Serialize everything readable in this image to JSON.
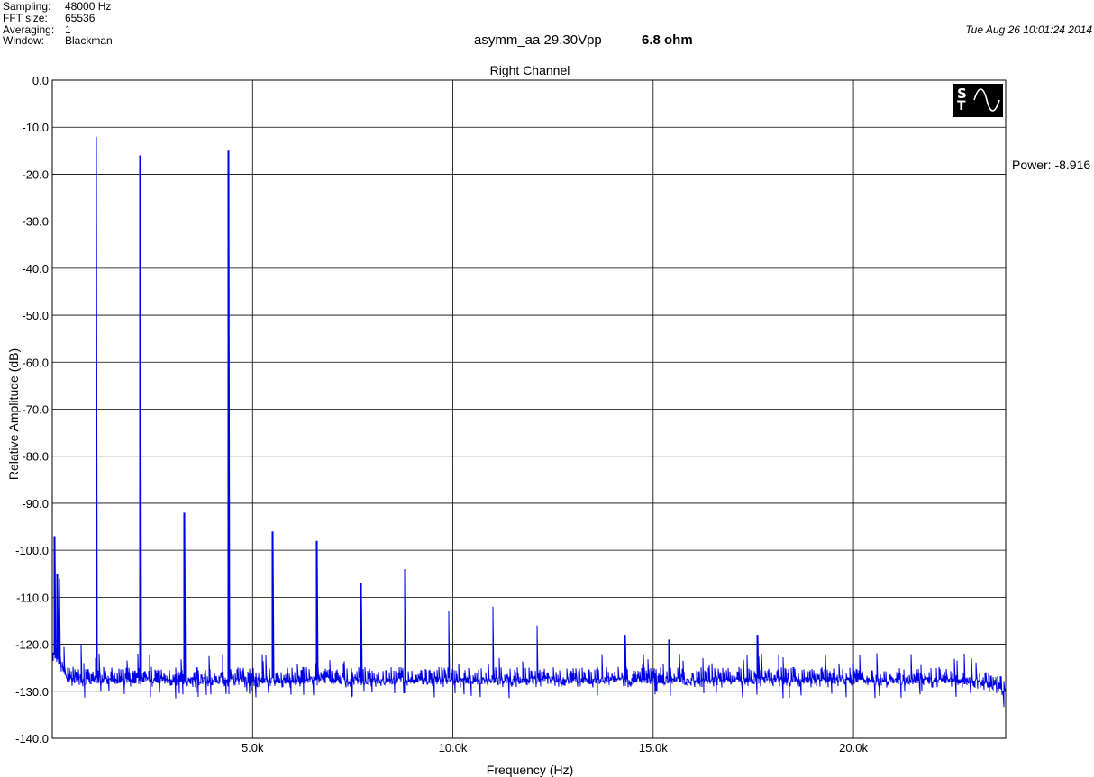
{
  "header": {
    "info": [
      {
        "label": "Sampling:",
        "value": "48000 Hz"
      },
      {
        "label": "FFT size:",
        "value": "65536"
      },
      {
        "label": "Averaging:",
        "value": "1"
      },
      {
        "label": "Window:",
        "value": "Blackman"
      }
    ],
    "title": "asymm_aa 29.30Vpp",
    "title_load": "6.8 ohm",
    "timestamp": "Tue Aug 26 10:01:24 2014",
    "power_readout": "Power: -8.916"
  },
  "logo": {
    "icon": "st-sine-logo",
    "letters": [
      "S",
      "T"
    ]
  },
  "chart_data": {
    "type": "line",
    "title": "Right Channel",
    "xlabel": "Frequency (Hz)",
    "ylabel": "Relative Amplitude (dB)",
    "xlim": [
      0,
      23800
    ],
    "ylim": [
      -140,
      0
    ],
    "grid": true,
    "x_ticks": [
      5000,
      10000,
      15000,
      20000
    ],
    "x_tick_labels": [
      "5.0k",
      "10.0k",
      "15.0k",
      "20.0k"
    ],
    "y_ticks": [
      0,
      -10,
      -20,
      -30,
      -40,
      -50,
      -60,
      -70,
      -80,
      -90,
      -100,
      -110,
      -120,
      -130,
      -140
    ],
    "y_tick_labels": [
      "0.0",
      "-10.0",
      "-20.0",
      "-30.0",
      "-40.0",
      "-50.0",
      "-60.0",
      "-70.0",
      "-80.0",
      "-90.0",
      "-100.0",
      "-110.0",
      "-120.0",
      "-130.0",
      "-140.0"
    ],
    "noise_floor_db": -127,
    "line_color": "#0000e6",
    "peaks": [
      {
        "x": 60,
        "y": -97
      },
      {
        "x": 120,
        "y": -105
      },
      {
        "x": 180,
        "y": -106
      },
      {
        "x": 720,
        "y": -120
      },
      {
        "x": 1100,
        "y": -12
      },
      {
        "x": 2200,
        "y": -16
      },
      {
        "x": 3300,
        "y": -92
      },
      {
        "x": 4400,
        "y": -15
      },
      {
        "x": 5500,
        "y": -96
      },
      {
        "x": 6600,
        "y": -98
      },
      {
        "x": 7700,
        "y": -107
      },
      {
        "x": 8800,
        "y": -104
      },
      {
        "x": 9900,
        "y": -113
      },
      {
        "x": 11000,
        "y": -112
      },
      {
        "x": 12100,
        "y": -116
      },
      {
        "x": 14300,
        "y": -118
      },
      {
        "x": 15400,
        "y": -119
      },
      {
        "x": 17600,
        "y": -118
      }
    ]
  }
}
